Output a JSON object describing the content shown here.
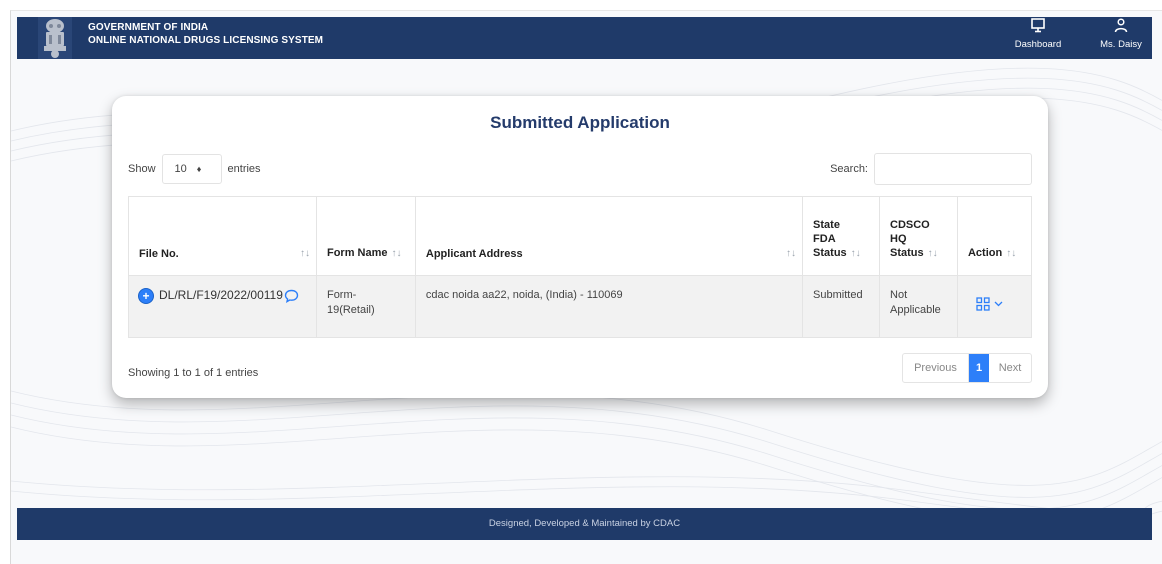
{
  "header": {
    "line1": "GOVERNMENT OF INDIA",
    "line2": "ONLINE NATIONAL DRUGS LICENSING SYSTEM",
    "dashboard_label": "Dashboard",
    "user_label": "Ms. Daisy"
  },
  "card": {
    "title": "Submitted Application",
    "show_label": "Show",
    "entries_label": "entries",
    "page_length": "10",
    "search_label": "Search:",
    "search_value": ""
  },
  "table": {
    "columns": {
      "file_no": "File No.",
      "form_name": "Form Name",
      "applicant_address": "Applicant Address",
      "state_fda_1": "State",
      "state_fda_2": "FDA",
      "state_fda_3": "Status",
      "cdsco_1": "CDSCO",
      "cdsco_2": "HQ",
      "cdsco_3": "Status",
      "action": "Action"
    },
    "rows": [
      {
        "file_no": "DL/RL/F19/2022/00119",
        "form_name_1": "Form-",
        "form_name_2": "19(Retail)",
        "applicant_address": "cdac noida aa22, noida, (India) - 110069",
        "state_fda_status": "Submitted",
        "cdsco_status_1": "Not",
        "cdsco_status_2": "Applicable"
      }
    ]
  },
  "info": "Showing 1 to 1 of 1 entries",
  "pagination": {
    "previous": "Previous",
    "current": "1",
    "next": "Next"
  },
  "footer": "Designed, Developed & Maintained by CDAC",
  "colors": {
    "navy": "#1f3a69",
    "accent_blue": "#2d7ff9",
    "title_blue": "#243b6b"
  }
}
